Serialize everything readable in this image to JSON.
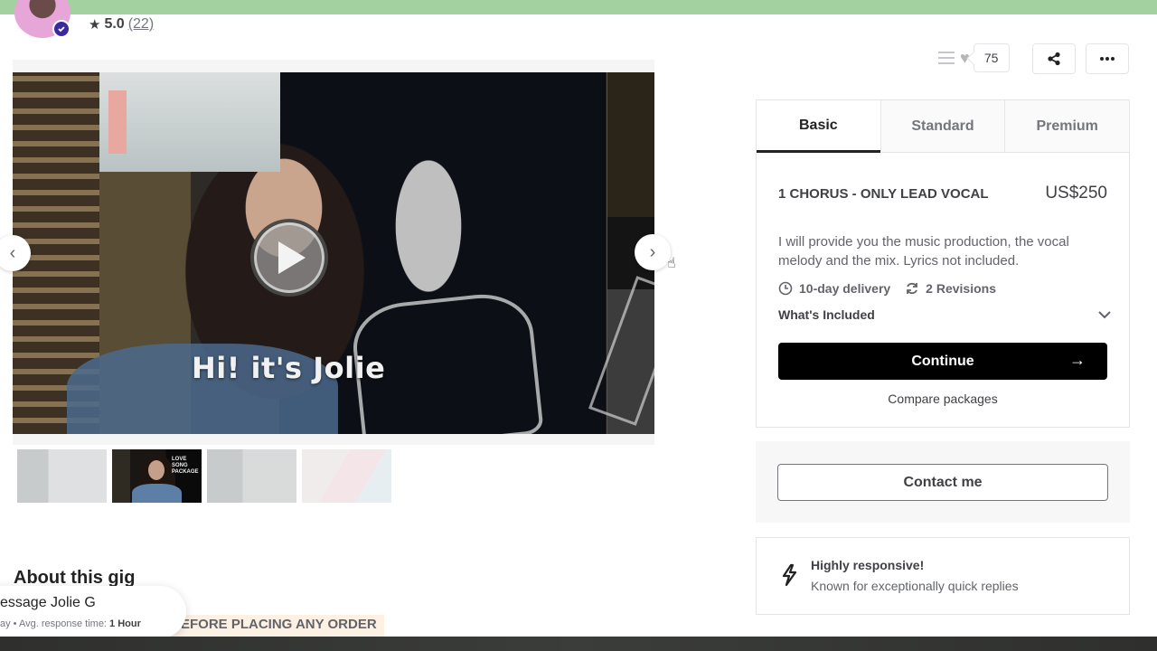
{
  "seller": {
    "rating": "5.0",
    "review_count": "(22)",
    "verified": true
  },
  "actions": {
    "icons": [
      "list-icon",
      "heart-icon",
      "share-icon",
      "more-icon"
    ],
    "saved_count": "75"
  },
  "gallery": {
    "video_caption": "Hi! it's Jolie",
    "thumbnails": [
      {
        "label": "",
        "active": false
      },
      {
        "label": "LOVE SONG PACKAGE",
        "active": true
      },
      {
        "label": "",
        "active": false
      },
      {
        "label": "",
        "active": false
      }
    ]
  },
  "about": {
    "title": "About this gig",
    "notice": "EFORE PLACING ANY ORDER"
  },
  "message_pill": {
    "title": "essage Jolie G",
    "sub_prefix": "ay  •  Avg. response time: ",
    "sub_value": "1 Hour"
  },
  "package": {
    "tabs": [
      {
        "label": "Basic",
        "active": true
      },
      {
        "label": "Standard",
        "active": false
      },
      {
        "label": "Premium",
        "active": false
      }
    ],
    "name": "1 CHORUS - ONLY LEAD VOCAL",
    "price": "US$250",
    "description": "I will provide you the music production, the vocal melody and the mix. Lyrics not included.",
    "delivery": "10-day delivery",
    "revisions": "2 Revisions",
    "whats_included": "What's Included",
    "continue_label": "Continue",
    "compare_label": "Compare packages"
  },
  "contact": {
    "button_label": "Contact me"
  },
  "responsive": {
    "title": "Highly responsive!",
    "subtitle": "Known for exceptionally quick replies"
  },
  "colors": {
    "primary_button": "#000000",
    "accent_band": "#a3d1a0",
    "verified_badge": "#3b2a9e",
    "notice_highlight": "#fdf1e3"
  }
}
